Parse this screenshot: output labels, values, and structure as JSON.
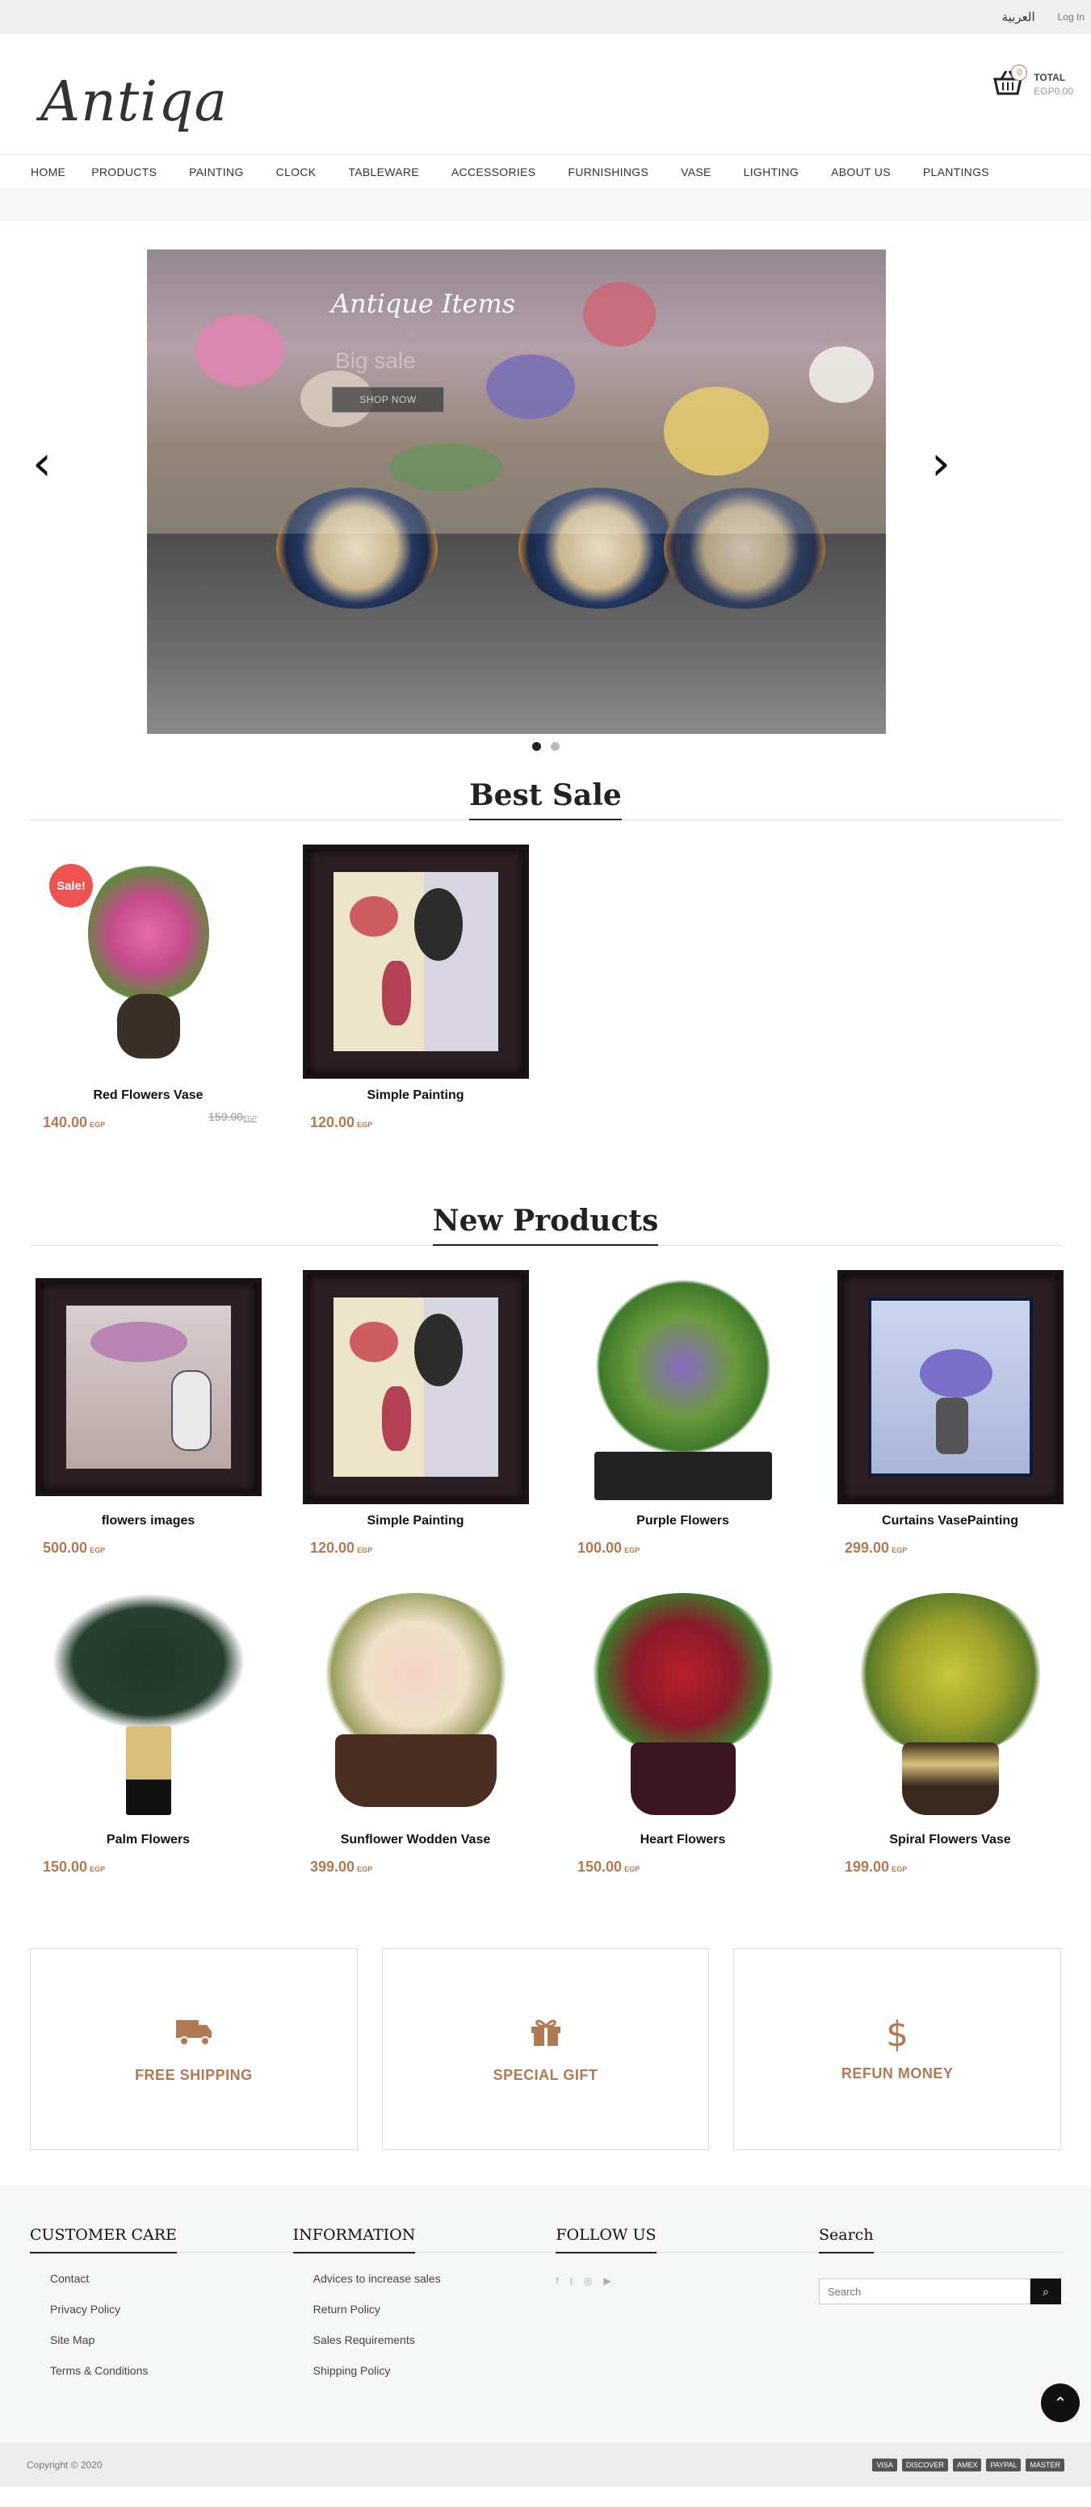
{
  "topbar": {
    "language": "العربية",
    "login": "Log In"
  },
  "header": {
    "logo": "Antiqa",
    "cart_count": "0",
    "total_label": "TOTAL",
    "total_amount": "EGP0.00"
  },
  "nav": [
    "HOME",
    "PRODUCTS",
    "PAINTING",
    "CLOCK",
    "TABLEWARE",
    "ACCESSORIES",
    "FURNISHINGS",
    "VASE",
    "LIGHTING",
    "ABOUT US",
    "PLANTINGS"
  ],
  "slider": {
    "title": "Antique Items",
    "subtitle": "Big sale",
    "button": "SHOP NOW",
    "prev": "‹",
    "next": "›"
  },
  "best_sale": {
    "title": "Best Sale",
    "products": [
      {
        "name": "Red Flowers Vase",
        "price": "140.00",
        "currency": "EGP",
        "old_price": "159.00",
        "badge": "Sale!"
      },
      {
        "name": "Simple Painting",
        "price": "120.00",
        "currency": "EGP"
      }
    ]
  },
  "new_products": {
    "title": "New Products",
    "products": [
      {
        "name": "flowers images",
        "price": "500.00",
        "currency": "EGP"
      },
      {
        "name": "Simple Painting",
        "price": "120.00",
        "currency": "EGP"
      },
      {
        "name": "Purple Flowers",
        "price": "100.00",
        "currency": "EGP"
      },
      {
        "name": "Curtains VasePainting",
        "price": "299.00",
        "currency": "EGP"
      },
      {
        "name": "Palm Flowers",
        "price": "150.00",
        "currency": "EGP"
      },
      {
        "name": "Sunflower Wodden Vase",
        "price": "399.00",
        "currency": "EGP"
      },
      {
        "name": "Heart Flowers",
        "price": "150.00",
        "currency": "EGP"
      },
      {
        "name": "Spiral Flowers Vase",
        "price": "199.00",
        "currency": "EGP"
      }
    ]
  },
  "features": [
    {
      "label": "FREE SHIPPING",
      "icon": "truck-icon"
    },
    {
      "label": "SPECIAL GIFT",
      "icon": "gift-icon"
    },
    {
      "label": "REFUN MONEY",
      "icon": "dollar-icon"
    }
  ],
  "footer": {
    "customer_care": {
      "title": "CUSTOMER CARE",
      "links": [
        "Contact",
        "Privacy Policy",
        "Site Map",
        "Terms & Conditions"
      ]
    },
    "information": {
      "title": "INFORMATION",
      "links": [
        "Advices to increase sales",
        "Return Policy",
        "Sales Requirements",
        "Shipping Policy"
      ]
    },
    "follow": {
      "title": "FOLLOW US",
      "icons": [
        "f",
        "t",
        "◎",
        "▶"
      ]
    },
    "search": {
      "title": "Search",
      "placeholder": "Search"
    }
  },
  "copyright": "Copyright © 2020",
  "payment": [
    "VISA",
    "DISCOVER",
    "AMEX",
    "PAYPAL",
    "MASTER"
  ],
  "colors": {
    "accent": "#b27a52",
    "sale": "#ef5350"
  }
}
